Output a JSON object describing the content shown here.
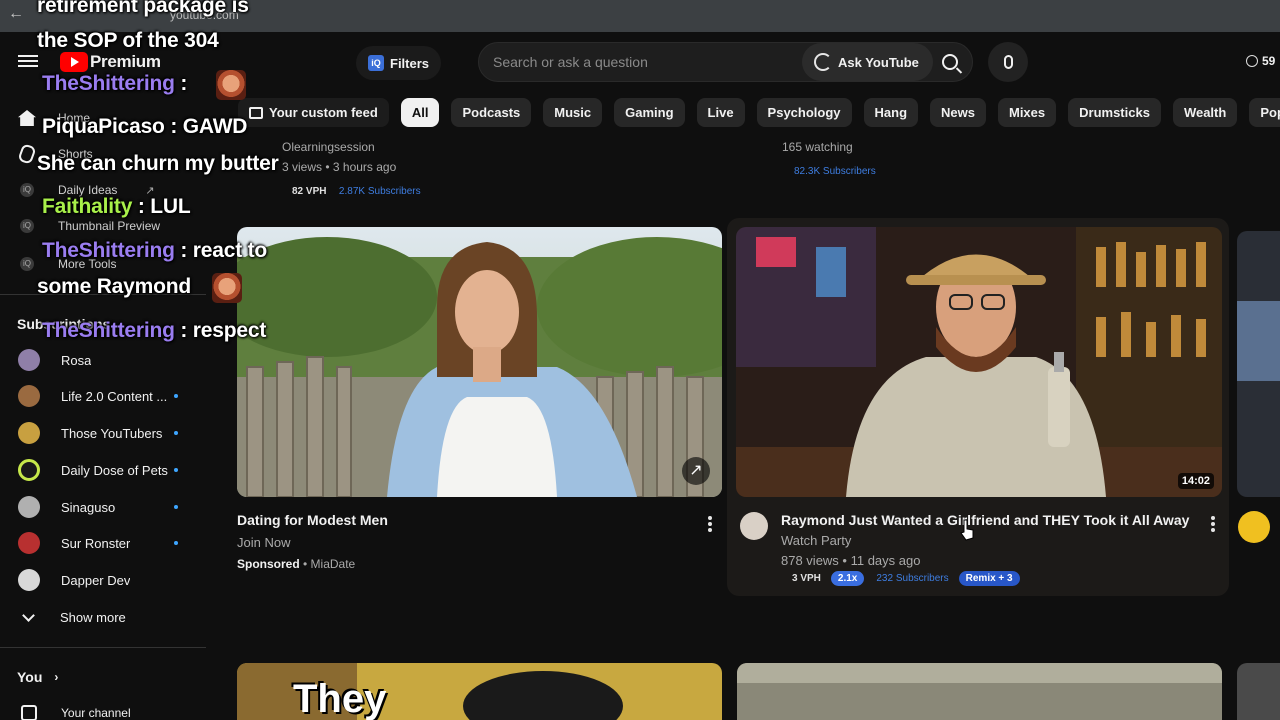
{
  "browser": {
    "url": "youtube.com"
  },
  "header": {
    "logo_text": "Premium",
    "filters_label": "Filters",
    "filters_icon_text": "iQ",
    "search_placeholder": "Search or ask a question",
    "ask_label": "Ask YouTube",
    "timer_text": "59"
  },
  "sidebar": {
    "nav": [
      {
        "label": "Home",
        "icon": "home-icon"
      },
      {
        "label": "Shorts",
        "icon": "shorts-icon"
      }
    ],
    "tools": [
      {
        "label": "Daily Ideas",
        "icon": "iq-icon"
      },
      {
        "label": "Thumbnail Preview",
        "icon": "iq-icon"
      },
      {
        "label": "More Tools",
        "icon": "iq-icon"
      }
    ],
    "tool_icon_text": "iQ",
    "subscriptions_title": "Subscriptions",
    "subscriptions": [
      {
        "name": "Rosa",
        "color": "#8f7fa8",
        "live": false
      },
      {
        "name": "Life 2.0 Content ...",
        "color": "#9a6a40",
        "live": true
      },
      {
        "name": "Those YouTubers",
        "color": "#c8a040",
        "live": true
      },
      {
        "name": "Daily Dose of Pets",
        "color": "#c6e84a",
        "live": true
      },
      {
        "name": "Sinaguso",
        "color": "#b0b0b0",
        "live": true
      },
      {
        "name": "Sur Ronster",
        "color": "#b83030",
        "live": true
      },
      {
        "name": "Dapper Dev",
        "color": "#d8d8d8",
        "live": false
      }
    ],
    "show_more": "Show more",
    "you_label": "You",
    "your_channel": "Your channel"
  },
  "chips": [
    "Your custom feed",
    "All",
    "Podcasts",
    "Music",
    "Gaming",
    "Live",
    "Psychology",
    "Hang",
    "News",
    "Mixes",
    "Drumsticks",
    "Wealth",
    "Pop Rock"
  ],
  "previous_row": {
    "left_channel": "Olearningsession",
    "left_meta": "3 views • 3 hours ago",
    "left_vph": "82 VPH",
    "left_subs": "2.87K Subscribers",
    "right_meta": "165 watching",
    "right_subs": "82.3K Subscribers"
  },
  "videos": [
    {
      "title": "Dating for Modest Men",
      "line2": "Join Now",
      "sponsored": "Sponsored",
      "advertiser": "• MiaDate"
    },
    {
      "title": "Raymond Just Wanted a Girlfriend and THEY Took it All Away",
      "channel": "Watch Party",
      "meta": "878 views • 11 days ago",
      "duration": "14:02",
      "vph": "3 VPH",
      "multiplier": "2.1x",
      "subs": "232 Subscribers",
      "remix": "Remix + 3"
    }
  ],
  "next_row": {
    "left_thumb_text": "They"
  },
  "chat": [
    {
      "user": "",
      "text": "retirement package is"
    },
    {
      "user": "",
      "text": "the SOP of the 304"
    },
    {
      "user": "TheShittering",
      "text": " :"
    },
    {
      "user": "PiquaPicaso",
      "text": " : GAWD"
    },
    {
      "user": "",
      "text": "She can churn my butter"
    },
    {
      "user": "Faithality",
      "text": " : LUL"
    },
    {
      "user": "TheShittering",
      "text": " : react to"
    },
    {
      "user": "",
      "text": "some Raymond"
    },
    {
      "user": "TheShittering",
      "text": " : respect"
    }
  ]
}
